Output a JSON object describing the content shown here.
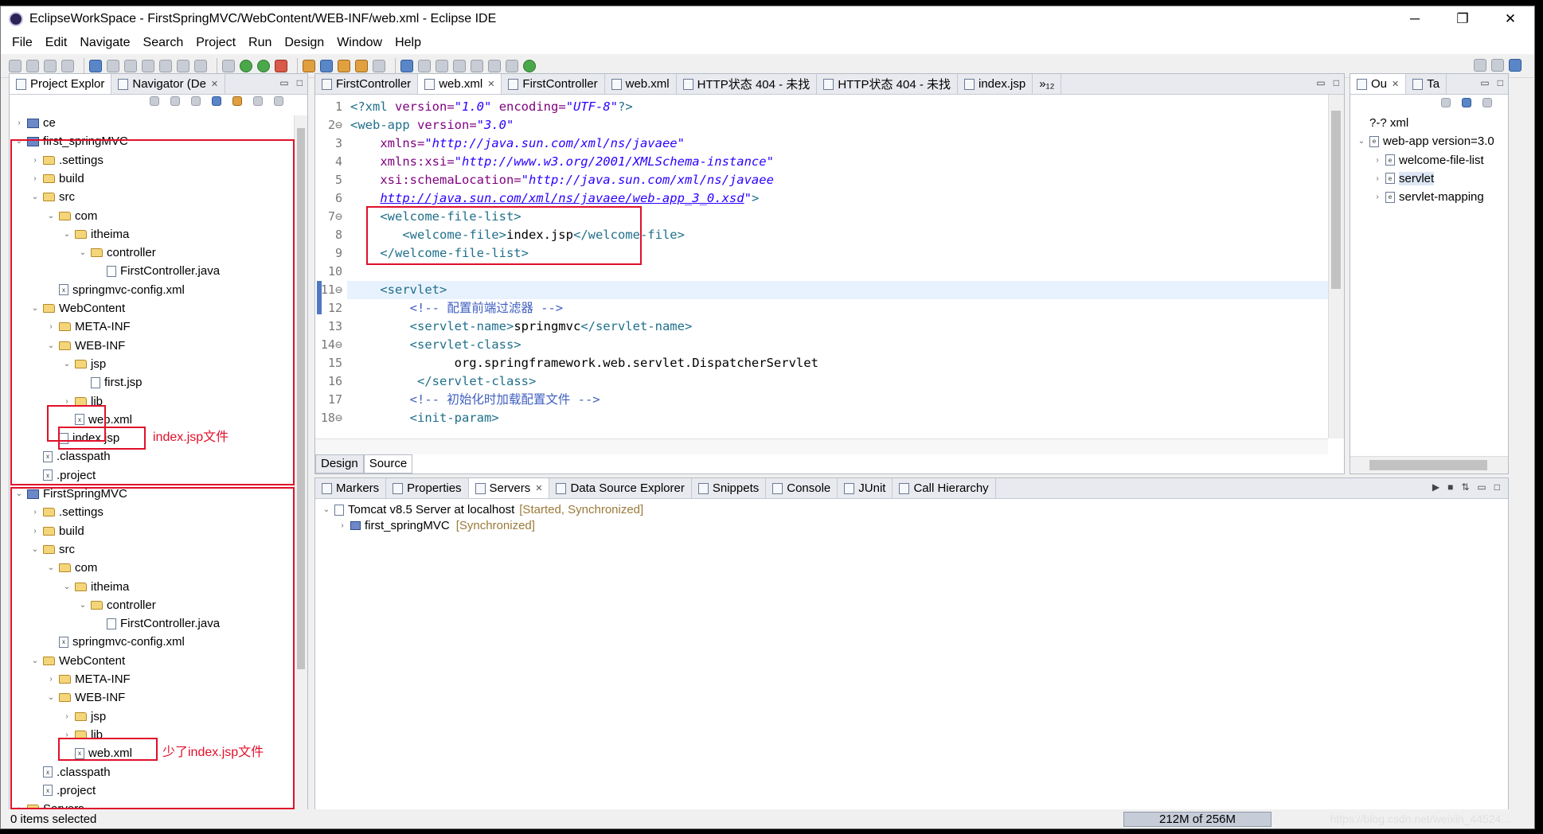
{
  "window": {
    "title": "EclipseWorkSpace - FirstSpringMVC/WebContent/WEB-INF/web.xml - Eclipse IDE",
    "controls": [
      "─",
      "❐",
      "✕"
    ]
  },
  "menu": [
    "File",
    "Edit",
    "Navigate",
    "Search",
    "Project",
    "Run",
    "Design",
    "Window",
    "Help"
  ],
  "explorer": {
    "tabs": [
      {
        "label": "Project Explor"
      },
      {
        "label": "Navigator (De"
      }
    ],
    "tree": [
      {
        "label": "ce",
        "indent": 0,
        "twisty": "›",
        "icon": "proj"
      },
      {
        "label": "first_springMVC",
        "indent": 0,
        "twisty": "⌄",
        "icon": "proj"
      },
      {
        "label": ".settings",
        "indent": 1,
        "twisty": "›",
        "icon": "folder"
      },
      {
        "label": "build",
        "indent": 1,
        "twisty": "›",
        "icon": "folder"
      },
      {
        "label": "src",
        "indent": 1,
        "twisty": "⌄",
        "icon": "folder"
      },
      {
        "label": "com",
        "indent": 2,
        "twisty": "⌄",
        "icon": "folder"
      },
      {
        "label": "itheima",
        "indent": 3,
        "twisty": "⌄",
        "icon": "folder"
      },
      {
        "label": "controller",
        "indent": 4,
        "twisty": "⌄",
        "icon": "folder"
      },
      {
        "label": "FirstController.java",
        "indent": 5,
        "twisty": "",
        "icon": "file"
      },
      {
        "label": "springmvc-config.xml",
        "indent": 2,
        "twisty": "",
        "icon": "xml"
      },
      {
        "label": "WebContent",
        "indent": 1,
        "twisty": "⌄",
        "icon": "folder"
      },
      {
        "label": "META-INF",
        "indent": 2,
        "twisty": "›",
        "icon": "folder"
      },
      {
        "label": "WEB-INF",
        "indent": 2,
        "twisty": "⌄",
        "icon": "folder"
      },
      {
        "label": "jsp",
        "indent": 3,
        "twisty": "⌄",
        "icon": "folder"
      },
      {
        "label": "first.jsp",
        "indent": 4,
        "twisty": "",
        "icon": "file"
      },
      {
        "label": "lib",
        "indent": 3,
        "twisty": "›",
        "icon": "folder"
      },
      {
        "label": "web.xml",
        "indent": 3,
        "twisty": "",
        "icon": "xml"
      },
      {
        "label": "index.jsp",
        "indent": 2,
        "twisty": "",
        "icon": "file"
      },
      {
        "label": ".classpath",
        "indent": 1,
        "twisty": "",
        "icon": "xml"
      },
      {
        "label": ".project",
        "indent": 1,
        "twisty": "",
        "icon": "xml"
      },
      {
        "label": "FirstSpringMVC",
        "indent": 0,
        "twisty": "⌄",
        "icon": "proj"
      },
      {
        "label": ".settings",
        "indent": 1,
        "twisty": "›",
        "icon": "folder"
      },
      {
        "label": "build",
        "indent": 1,
        "twisty": "›",
        "icon": "folder"
      },
      {
        "label": "src",
        "indent": 1,
        "twisty": "⌄",
        "icon": "folder"
      },
      {
        "label": "com",
        "indent": 2,
        "twisty": "⌄",
        "icon": "folder"
      },
      {
        "label": "itheima",
        "indent": 3,
        "twisty": "⌄",
        "icon": "folder"
      },
      {
        "label": "controller",
        "indent": 4,
        "twisty": "⌄",
        "icon": "folder"
      },
      {
        "label": "FirstController.java",
        "indent": 5,
        "twisty": "",
        "icon": "file"
      },
      {
        "label": "springmvc-config.xml",
        "indent": 2,
        "twisty": "",
        "icon": "xml"
      },
      {
        "label": "WebContent",
        "indent": 1,
        "twisty": "⌄",
        "icon": "folder"
      },
      {
        "label": "META-INF",
        "indent": 2,
        "twisty": "›",
        "icon": "folder"
      },
      {
        "label": "WEB-INF",
        "indent": 2,
        "twisty": "⌄",
        "icon": "folder"
      },
      {
        "label": "jsp",
        "indent": 3,
        "twisty": "›",
        "icon": "folder"
      },
      {
        "label": "lib",
        "indent": 3,
        "twisty": "›",
        "icon": "folder"
      },
      {
        "label": "web.xml",
        "indent": 3,
        "twisty": "",
        "icon": "xml"
      },
      {
        "label": ".classpath",
        "indent": 1,
        "twisty": "",
        "icon": "xml"
      },
      {
        "label": ".project",
        "indent": 1,
        "twisty": "",
        "icon": "xml"
      },
      {
        "label": "Servers",
        "indent": 0,
        "twisty": "›",
        "icon": "folder"
      }
    ],
    "annotation_1": "index.jsp文件",
    "annotation_2": "少了index.jsp文件"
  },
  "editor": {
    "tabs": [
      {
        "label": "FirstController",
        "active": false
      },
      {
        "label": "web.xml",
        "active": true
      },
      {
        "label": "FirstController",
        "active": false
      },
      {
        "label": "web.xml",
        "active": false
      },
      {
        "label": "HTTP状态 404 - 未找",
        "active": false
      },
      {
        "label": "HTTP状态 404 - 未找",
        "active": false
      },
      {
        "label": "index.jsp",
        "active": false
      }
    ],
    "overflow": "»₁₂",
    "lines": [
      {
        "n": "1",
        "html": "<span class='tag'>&lt;?xml</span> <span class='an'>version=</span><span class='av'>\"1.0\"</span> <span class='an'>encoding=</span><span class='av'>\"UTF-8\"</span><span class='tag'>?&gt;</span>"
      },
      {
        "n": "2⊖",
        "html": "<span class='tag'>&lt;web-app</span> <span class='an'>version=</span><span class='av'>\"3.0\"</span>"
      },
      {
        "n": "3",
        "html": "    <span class='an'>xmlns=</span><span class='av'>\"http://java.sun.com/xml/ns/javaee\"</span>"
      },
      {
        "n": "4",
        "html": "    <span class='an'>xmlns:xsi=</span><span class='av'>\"http://www.w3.org/2001/XMLSchema-instance\"</span>"
      },
      {
        "n": "5",
        "html": "    <span class='an'>xsi:schemaLocation=</span><span class='av'>\"http://java.sun.com/xml/ns/javaee</span>"
      },
      {
        "n": "6",
        "html": "    <span class='av'><u>http://java.sun.com/xml/ns/javaee/web-app_3_0.xsd</u>\"</span><span class='tag'>&gt;</span>"
      },
      {
        "n": "7⊖",
        "html": "    <span class='tag'>&lt;welcome-file-list&gt;</span>"
      },
      {
        "n": "8",
        "html": "       <span class='tag'>&lt;welcome-file&gt;</span>index.jsp<span class='tag'>&lt;/welcome-file&gt;</span>"
      },
      {
        "n": "9",
        "html": "    <span class='tag'>&lt;/welcome-file-list&gt;</span>"
      },
      {
        "n": "10",
        "html": ""
      },
      {
        "n": "11⊖",
        "html": "    <span class='tag'>&lt;servlet&gt;</span>"
      },
      {
        "n": "12",
        "html": "        <span class='cm'>&lt;!-- 配置前端过滤器 --&gt;</span>"
      },
      {
        "n": "13",
        "html": "        <span class='tag'>&lt;servlet-name&gt;</span>springmvc<span class='tag'>&lt;/servlet-name&gt;</span>"
      },
      {
        "n": "14⊖",
        "html": "        <span class='tag'>&lt;servlet-class&gt;</span>"
      },
      {
        "n": "15",
        "html": "              org.springframework.web.servlet.DispatcherServlet"
      },
      {
        "n": "16",
        "html": "         <span class='tag'>&lt;/servlet-class&gt;</span>"
      },
      {
        "n": "17",
        "html": "        <span class='cm'>&lt;!-- 初始化时加载配置文件 --&gt;</span>"
      },
      {
        "n": "18⊖",
        "html": "        <span class='tag'>&lt;init-param&gt;</span>"
      }
    ],
    "bottom_tabs": [
      "Design",
      "Source"
    ]
  },
  "outline": {
    "tabs": [
      {
        "label": "Ou"
      },
      {
        "label": "Ta"
      }
    ],
    "items": [
      {
        "label": "?-? xml",
        "indent": 0,
        "twisty": ""
      },
      {
        "label": "web-app version=3.0",
        "indent": 0,
        "twisty": "⌄"
      },
      {
        "label": "welcome-file-list",
        "indent": 1,
        "twisty": "›"
      },
      {
        "label": "servlet",
        "indent": 1,
        "twisty": "›"
      },
      {
        "label": "servlet-mapping",
        "indent": 1,
        "twisty": "›"
      }
    ]
  },
  "bottom_panel": {
    "tabs": [
      {
        "label": "Markers"
      },
      {
        "label": "Properties"
      },
      {
        "label": "Servers"
      },
      {
        "label": "Data Source Explorer"
      },
      {
        "label": "Snippets"
      },
      {
        "label": "Console"
      },
      {
        "label": "JUnit"
      },
      {
        "label": "Call Hierarchy"
      }
    ],
    "server": {
      "name": "Tomcat v8.5 Server at localhost",
      "state": "[Started, Synchronized]"
    },
    "module": {
      "name": "first_springMVC",
      "state": "[Synchronized]"
    }
  },
  "status": {
    "left": "0 items selected",
    "heap": "212M of 256M",
    "watermark": "https://blog.csdn.net/weixin_44524..."
  },
  "colors": {
    "annotation_red": "#e0102a",
    "tag": "#1f6f8b",
    "attr_value": "#2a00ff",
    "comment": "#3f5fbf"
  }
}
